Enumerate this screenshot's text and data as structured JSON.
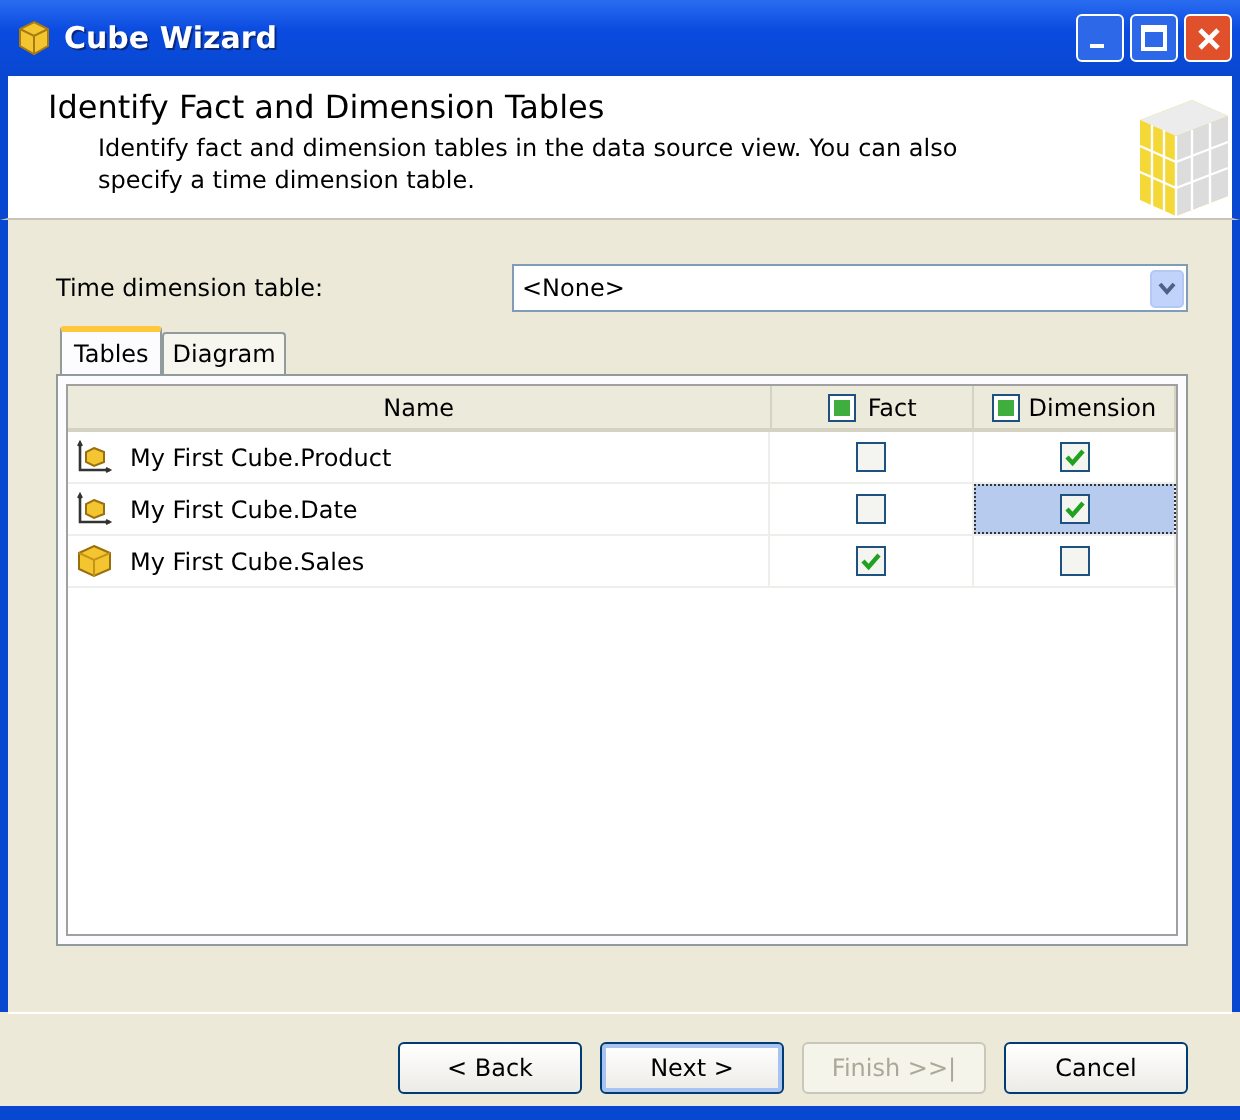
{
  "window": {
    "title": "Cube Wizard"
  },
  "header": {
    "title": "Identify Fact and Dimension Tables",
    "description": "Identify fact and dimension tables in the data source view. You can also specify a time dimension table."
  },
  "time_dimension": {
    "label": "Time dimension table:",
    "value": "<None>"
  },
  "tabs": [
    {
      "label": "Tables",
      "selected": true
    },
    {
      "label": "Diagram",
      "selected": false
    }
  ],
  "table": {
    "columns": [
      "Name",
      "Fact",
      "Dimension"
    ],
    "rows": [
      {
        "kind": "dimension",
        "name": "My First Cube.Product",
        "fact": false,
        "dimension": true,
        "selected": false
      },
      {
        "kind": "dimension",
        "name": "My First Cube.Date",
        "fact": false,
        "dimension": true,
        "selected": true
      },
      {
        "kind": "fact",
        "name": "My First Cube.Sales",
        "fact": true,
        "dimension": false,
        "selected": false
      }
    ]
  },
  "buttons": [
    {
      "label": "< Back",
      "disabled": false,
      "default": false
    },
    {
      "label": "Next >",
      "disabled": false,
      "default": true
    },
    {
      "label": "Finish >>|",
      "disabled": true,
      "default": false
    },
    {
      "label": "Cancel",
      "disabled": false,
      "default": false
    }
  ]
}
